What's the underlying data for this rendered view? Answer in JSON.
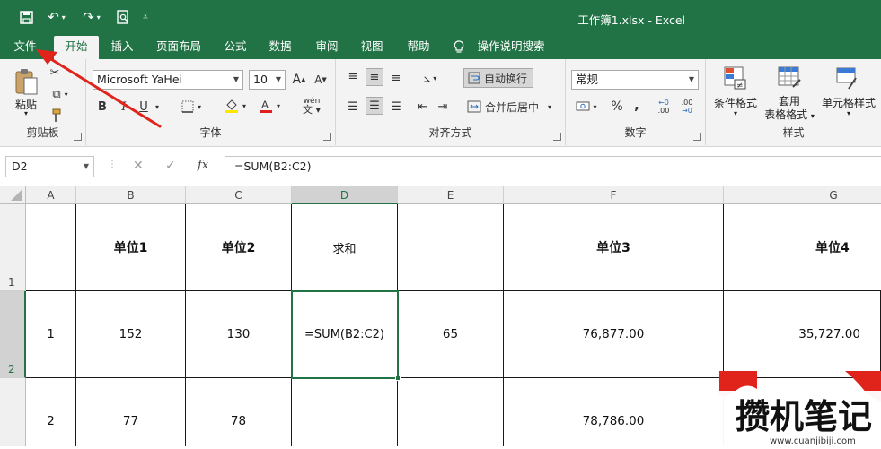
{
  "window": {
    "title": "工作簿1.xlsx - Excel"
  },
  "tabs": [
    "文件",
    "开始",
    "插入",
    "页面布局",
    "公式",
    "数据",
    "审阅",
    "视图",
    "帮助",
    "操作说明搜索"
  ],
  "ribbon": {
    "clipboard": {
      "label": "剪贴板",
      "paste": "粘贴"
    },
    "font": {
      "label": "字体",
      "font_name": "Microsoft YaHei",
      "font_size": "10",
      "grow": "A",
      "shrink": "A",
      "bold": "B",
      "italic": "I",
      "underline": "U",
      "phonetic": "wén"
    },
    "alignment": {
      "label": "对齐方式",
      "wrap_text": "自动换行",
      "merge_center": "合并后居中"
    },
    "number": {
      "label": "数字",
      "format": "常规",
      "percent": "%",
      "comma": ",",
      "inc_decimal": ".00",
      "dec_decimal": ".00"
    },
    "styles": {
      "label": "样式",
      "conditional": "条件格式",
      "table_line1": "套用",
      "table_line2": "表格格式",
      "cell_styles": "单元格样式"
    }
  },
  "formula_bar": {
    "name_box": "D2",
    "fx": "fx",
    "formula": "=SUM(B2:C2)"
  },
  "sheet": {
    "columns": [
      "A",
      "B",
      "C",
      "D",
      "E",
      "F",
      "G"
    ],
    "rows": [
      {
        "num": "1",
        "cells": [
          "",
          "单位1",
          "单位2",
          "求和",
          "",
          "单位3",
          "单位4"
        ]
      },
      {
        "num": "2",
        "cells": [
          "1",
          "152",
          "130",
          "=SUM(B2:C2)",
          "65",
          "76,877.00",
          "35,727.00"
        ]
      },
      {
        "num": "",
        "cells": [
          "2",
          "77",
          "78",
          "",
          "",
          "78,786.00",
          ""
        ]
      }
    ]
  },
  "watermark": {
    "text": "攒机笔记",
    "url": "www.cuanjibiji.com"
  },
  "colors": {
    "excel_green": "#217346",
    "arrow_red": "#e0241b"
  }
}
